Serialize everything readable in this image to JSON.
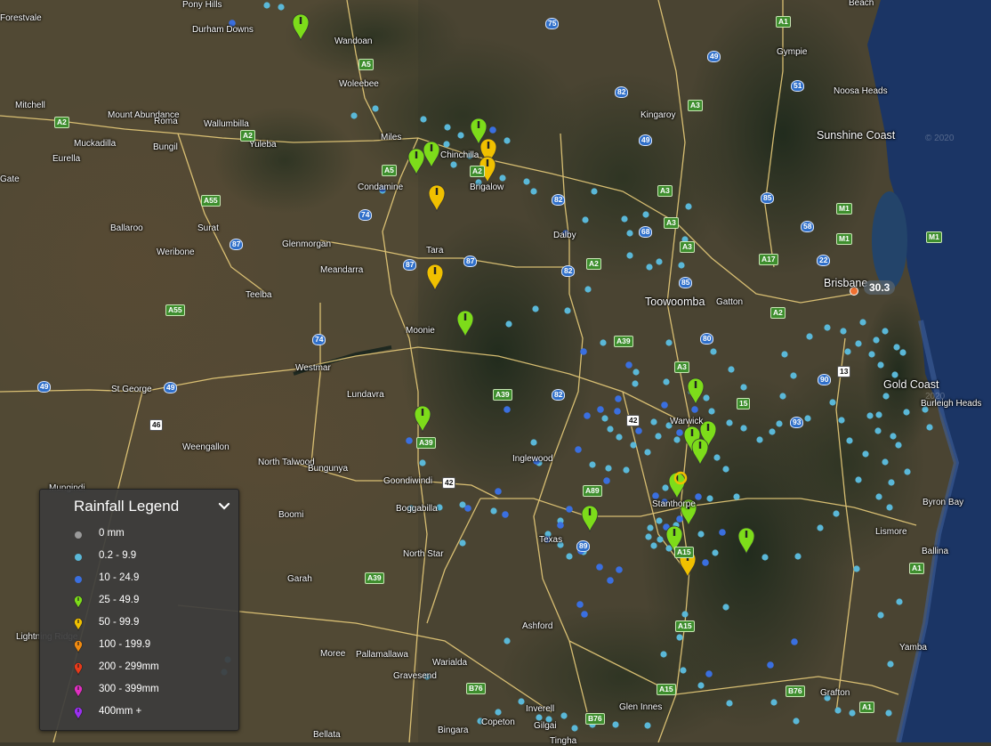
{
  "map": {
    "places": [
      {
        "name": "Pony Hills"
      },
      {
        "name": "Forestvale"
      },
      {
        "name": "Durham Downs"
      },
      {
        "name": "Wandoan"
      },
      {
        "name": "Woleebee"
      },
      {
        "name": "Beach"
      },
      {
        "name": "Gympie"
      },
      {
        "name": "Noosa Heads"
      },
      {
        "name": "Sunshine Coast"
      },
      {
        "name": "Kingaroy"
      },
      {
        "name": "Mitchell"
      },
      {
        "name": "Mount Abundance"
      },
      {
        "name": "Roma"
      },
      {
        "name": "Wallumbilla"
      },
      {
        "name": "Muckadilla"
      },
      {
        "name": "Bungil"
      },
      {
        "name": "Yuleba"
      },
      {
        "name": "Miles"
      },
      {
        "name": "Chinchilla"
      },
      {
        "name": "Eurella"
      },
      {
        "name": "Gate"
      },
      {
        "name": "Condamine"
      },
      {
        "name": "Brigalow"
      },
      {
        "name": "Ballaroo"
      },
      {
        "name": "Surat"
      },
      {
        "name": "Weribone"
      },
      {
        "name": "Glenmorgan"
      },
      {
        "name": "Tara"
      },
      {
        "name": "Dalby"
      },
      {
        "name": "Meandarra"
      },
      {
        "name": "Brisbane"
      },
      {
        "name": "Teelba"
      },
      {
        "name": "Toowoomba"
      },
      {
        "name": "Gatton"
      },
      {
        "name": "Moonie"
      },
      {
        "name": "Westmar"
      },
      {
        "name": "Gold Coast"
      },
      {
        "name": "St George"
      },
      {
        "name": "Lundavra"
      },
      {
        "name": "Burleigh Heads"
      },
      {
        "name": "Warwick"
      },
      {
        "name": "Weengallon"
      },
      {
        "name": "North Talwood"
      },
      {
        "name": "Bungunya"
      },
      {
        "name": "Inglewood"
      },
      {
        "name": "Goondiwindi"
      },
      {
        "name": "Boomi"
      },
      {
        "name": "Boggabilla"
      },
      {
        "name": "Stanthorpe"
      },
      {
        "name": "Byron Bay"
      },
      {
        "name": "Texas"
      },
      {
        "name": "Lismore"
      },
      {
        "name": "Ballina"
      },
      {
        "name": "North Star"
      },
      {
        "name": "Mungindi"
      },
      {
        "name": "Garah"
      },
      {
        "name": "Ashford"
      },
      {
        "name": "Yamba"
      },
      {
        "name": "Lightning Ridge"
      },
      {
        "name": "Moree"
      },
      {
        "name": "Pallamallawa"
      },
      {
        "name": "Warialda"
      },
      {
        "name": "Gravesend"
      },
      {
        "name": "Grafton"
      },
      {
        "name": "Glen Innes"
      },
      {
        "name": "Inverell"
      },
      {
        "name": "Copeton"
      },
      {
        "name": "Bingara"
      },
      {
        "name": "Bellata"
      },
      {
        "name": "Gilgai"
      },
      {
        "name": "Tingha"
      }
    ],
    "shields": [
      "A1",
      "75",
      "49",
      "A5",
      "82",
      "A3",
      "51",
      "A2",
      "A2",
      "49",
      "A2",
      "A5",
      "A3",
      "A55",
      "74",
      "82",
      "85",
      "M1",
      "87",
      "A3",
      "A3",
      "58",
      "M1",
      "68",
      "87",
      "87",
      "A2",
      "A17",
      "22",
      "M1",
      "82",
      "85",
      "A55",
      "A2",
      "74",
      "A39",
      "80",
      "90",
      "13",
      "49",
      "49",
      "A3",
      "46",
      "A39",
      "82",
      "15",
      "93",
      "A39",
      "42",
      "A89",
      "42",
      "89",
      "A15",
      "A39",
      "B76",
      "A15",
      "B76",
      "A1",
      "A1",
      "A15",
      "B76"
    ],
    "readout": "30.3"
  },
  "legend": {
    "title": "Rainfall Legend",
    "items": [
      {
        "label": "0 mm",
        "shape": "dot",
        "color": "#9a9a9a"
      },
      {
        "label": "0.2 - 9.9",
        "shape": "dot",
        "color": "#5ab8d8"
      },
      {
        "label": "10 - 24.9",
        "shape": "dot",
        "color": "#3a6fe0"
      },
      {
        "label": "25 - 49.9",
        "shape": "pin",
        "color": "#7ddc1a"
      },
      {
        "label": "50 - 99.9",
        "shape": "pin",
        "color": "#f0c000"
      },
      {
        "label": "100 - 199.9",
        "shape": "pin",
        "color": "#f08a10"
      },
      {
        "label": "200 - 299mm",
        "shape": "pin",
        "color": "#e83a1a"
      },
      {
        "label": "300 - 399mm",
        "shape": "pin",
        "color": "#e030c0"
      },
      {
        "label": "400mm +",
        "shape": "pin",
        "color": "#9a30f0"
      }
    ]
  },
  "colors": {
    "light_blue": "#5ab8d8",
    "dark_blue": "#3a6fe0",
    "green_pin": "#7ddc1a",
    "yellow_pin": "#f0c000",
    "orange_marker": "#f07030",
    "road": "#e8cc7a",
    "ocean": "#1b3565"
  }
}
